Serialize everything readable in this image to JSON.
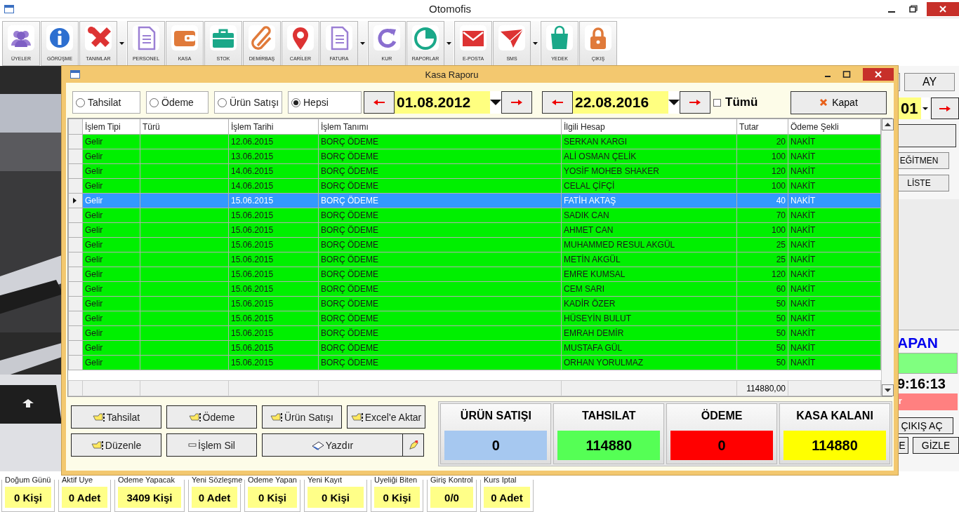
{
  "window": {
    "title": "Otomofis"
  },
  "toolbar": [
    {
      "label": "ÜYELER",
      "has_menu": false
    },
    {
      "label": "GÖRÜŞME",
      "has_menu": false
    },
    {
      "label": "TANIMLAR",
      "has_menu": true
    },
    {
      "label": "PERSONEL",
      "has_menu": false
    },
    {
      "label": "KASA",
      "has_menu": false
    },
    {
      "label": "STOK",
      "has_menu": false
    },
    {
      "label": "DEMİRBAŞ",
      "has_menu": false
    },
    {
      "label": "CARİLER",
      "has_menu": false
    },
    {
      "label": "FATURA",
      "has_menu": true
    },
    {
      "label": "KUR",
      "has_menu": false
    },
    {
      "label": "RAPORLAR",
      "has_menu": true
    },
    {
      "label": "E-POSTA",
      "has_menu": false
    },
    {
      "label": "SMS",
      "has_menu": true
    },
    {
      "label": "YEDEK",
      "has_menu": false
    },
    {
      "label": "ÇIKIŞ",
      "has_menu": false
    }
  ],
  "side_panel": {
    "month_button": "AY",
    "date": "01",
    "teacher_button": "EĞİTMEN",
    "list_button": "LİSTE",
    "heading": "APAN",
    "clock": "9:16:13",
    "alert": "r",
    "exit_button": "ÇIKIŞ AÇ",
    "small_button": "E",
    "hide_button": "GİZLE"
  },
  "dialog": {
    "title": "Kasa Raporu",
    "filters": [
      {
        "label": "Tahsilat",
        "selected": false
      },
      {
        "label": "Ödeme",
        "selected": false
      },
      {
        "label": "Ürün Satışı",
        "selected": false
      },
      {
        "label": "Hepsi",
        "selected": true
      }
    ],
    "start_date": "01.08.2012",
    "end_date": "22.08.2016",
    "all_dates": {
      "label": "Tümü",
      "checked": false
    },
    "close_button": "Kapat",
    "table": {
      "columns": [
        "İşlem Tipi",
        "Türü",
        "İşlem Tarihi",
        "İşlem Tanımı",
        "İlgili Hesap",
        "Tutar",
        "Ödeme Şekli"
      ],
      "rows": [
        {
          "type": "Gelir",
          "date": "12.06.2015",
          "description": "BORÇ ÖDEME",
          "account": "SERKAN KARGI",
          "amount": "20",
          "payment": "NAKİT",
          "selected": false
        },
        {
          "type": "Gelir",
          "date": "13.06.2015",
          "description": "BORÇ ÖDEME",
          "account": "ALİ OSMAN ÇELİK",
          "amount": "100",
          "payment": "NAKİT",
          "selected": false
        },
        {
          "type": "Gelir",
          "date": "14.06.2015",
          "description": "BORÇ ÖDEME",
          "account": "YOSİF MOHEB SHAKER",
          "amount": "120",
          "payment": "NAKİT",
          "selected": false
        },
        {
          "type": "Gelir",
          "date": "14.06.2015",
          "description": "BORÇ ÖDEME",
          "account": "CELAL ÇİFÇİ",
          "amount": "100",
          "payment": "NAKİT",
          "selected": false
        },
        {
          "type": "Gelir",
          "date": "15.06.2015",
          "description": "BORÇ ÖDEME",
          "account": "FATİH AKTAŞ",
          "amount": "40",
          "payment": "NAKİT",
          "selected": true
        },
        {
          "type": "Gelir",
          "date": "15.06.2015",
          "description": "BORÇ ÖDEME",
          "account": "SADIK CAN",
          "amount": "70",
          "payment": "NAKİT",
          "selected": false
        },
        {
          "type": "Gelir",
          "date": "15.06.2015",
          "description": "BORÇ ÖDEME",
          "account": "AHMET CAN",
          "amount": "100",
          "payment": "NAKİT",
          "selected": false
        },
        {
          "type": "Gelir",
          "date": "15.06.2015",
          "description": "BORÇ ÖDEME",
          "account": "MUHAMMED RESUL AKGÜL",
          "amount": "25",
          "payment": "NAKİT",
          "selected": false
        },
        {
          "type": "Gelir",
          "date": "15.06.2015",
          "description": "BORÇ ÖDEME",
          "account": "METİN AKGÜL",
          "amount": "25",
          "payment": "NAKİT",
          "selected": false
        },
        {
          "type": "Gelir",
          "date": "15.06.2015",
          "description": "BORÇ ÖDEME",
          "account": "EMRE KUMSAL",
          "amount": "120",
          "payment": "NAKİT",
          "selected": false
        },
        {
          "type": "Gelir",
          "date": "15.06.2015",
          "description": "BORÇ ÖDEME",
          "account": "CEM SARI",
          "amount": "60",
          "payment": "NAKİT",
          "selected": false
        },
        {
          "type": "Gelir",
          "date": "15.06.2015",
          "description": "BORÇ ÖDEME",
          "account": "KADİR ÖZER",
          "amount": "50",
          "payment": "NAKİT",
          "selected": false
        },
        {
          "type": "Gelir",
          "date": "15.06.2015",
          "description": "BORÇ ÖDEME",
          "account": "HÜSEYİN BULUT",
          "amount": "50",
          "payment": "NAKİT",
          "selected": false
        },
        {
          "type": "Gelir",
          "date": "15.06.2015",
          "description": "BORÇ ÖDEME",
          "account": "EMRAH DEMİR",
          "amount": "50",
          "payment": "NAKİT",
          "selected": false
        },
        {
          "type": "Gelir",
          "date": "15.06.2015",
          "description": "BORÇ ÖDEME",
          "account": "MUSTAFA GÜL",
          "amount": "50",
          "payment": "NAKİT",
          "selected": false
        },
        {
          "type": "Gelir",
          "date": "15.06.2015",
          "description": "BORÇ ÖDEME",
          "account": "ORHAN YORULMAZ",
          "amount": "50",
          "payment": "NAKİT",
          "selected": false
        }
      ],
      "total": "114880,00"
    },
    "actions": [
      [
        {
          "kind": "hand",
          "label": "Tahsilat"
        },
        {
          "kind": "hand",
          "label": "Ödeme"
        },
        {
          "kind": "hand",
          "label": "Ürün Satışı"
        },
        {
          "kind": "hand",
          "label": "Excel'e Aktar"
        }
      ],
      [
        {
          "kind": "hand",
          "label": "Düzenle"
        },
        {
          "kind": "minus",
          "label": "İşlem Sil"
        },
        {
          "kind": "book",
          "label": "Yazdır"
        },
        {
          "kind": "pen"
        }
      ]
    ],
    "summary": [
      {
        "title": "ÜRÜN SATIŞI",
        "value": "0",
        "color": "#a6c8f0"
      },
      {
        "title": "TAHSILAT",
        "value": "114880",
        "color": "#55ff55"
      },
      {
        "title": "ÖDEME",
        "value": "0",
        "color": "#ff0000"
      },
      {
        "title": "KASA KALANI",
        "value": "114880",
        "color": "#ffff00"
      }
    ]
  },
  "stats": [
    {
      "label": "Doğum Günü",
      "value": "0 Kişi"
    },
    {
      "label": "Aktif Uye",
      "value": "0 Adet"
    },
    {
      "label": "Odeme Yapacak",
      "value": "3409 Kişi"
    },
    {
      "label": "Yeni Sözleşme",
      "value": "0 Adet"
    },
    {
      "label": "Odeme Yapan",
      "value": "0 Kişi"
    },
    {
      "label": "Yeni Kayıt",
      "value": "0 Kişi"
    },
    {
      "label": "Uyeliği Biten",
      "value": "0 Kişi"
    },
    {
      "label": "Giriş Kontrol",
      "value": "0/0"
    },
    {
      "label": "Kurs Iptal",
      "value": "0 Adet"
    }
  ]
}
